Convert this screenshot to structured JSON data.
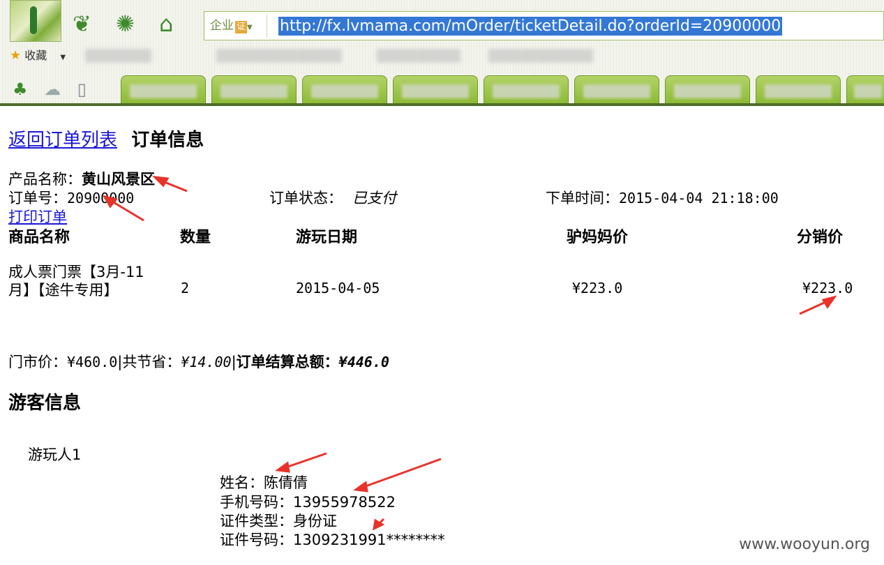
{
  "browser": {
    "address_badge": "企业",
    "address_badge_cert": "证",
    "url": "http://fx.lvmama.com/mOrder/ticketDetail.do?orderId=20900000",
    "favorites_label": "收藏"
  },
  "page": {
    "back_link": "返回订单列表",
    "title": "订单信息",
    "product_label": "产品名称：",
    "product_name": "黄山风景区",
    "order_no_label": "订单号：",
    "order_no": "20900000",
    "status_label": "订单状态：",
    "status_value": "已支付",
    "time_label": "下单时间：",
    "time_value": "2015-04-04 21:18:00",
    "print_link": "打印订单"
  },
  "table": {
    "headers": [
      "商品名称",
      "数量",
      "游玩日期",
      "驴妈妈价",
      "分销价"
    ],
    "row": {
      "name_line1": "成人票门票【3月-11",
      "name_line2": "月】【途牛专用】",
      "qty": "2",
      "date": "2015-04-05",
      "lvmama_price": "¥223.0",
      "dist_price": "¥223.0"
    }
  },
  "summary": {
    "market_label": "门市价：",
    "market_value": "¥460.0",
    "save_label": "共节省：",
    "save_value": "¥14.00",
    "total_label": "订单结算总额：",
    "total_value": "¥446.0"
  },
  "visitor": {
    "section_title": "游客信息",
    "person_label": "游玩人1",
    "name_label": "姓名：",
    "name_value": "陈倩倩",
    "phone_label": "手机号码：",
    "phone_value": "13955978522",
    "idtype_label": "证件类型：",
    "idtype_value": "身份证",
    "idno_label": "证件号码：",
    "idno_value": "1309231991********"
  },
  "watermark": "www.wooyun.org",
  "colors": {
    "link": "#1a17d6",
    "arrow": "#e8332a",
    "chrome_green": "#8cbb34",
    "url_highlight": "#3478d6"
  }
}
